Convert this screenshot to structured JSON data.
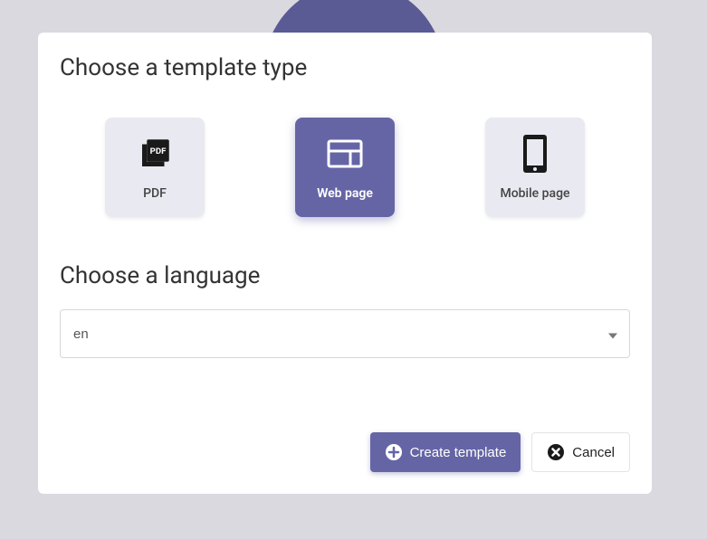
{
  "modal": {
    "template_type_title": "Choose a template type",
    "options": [
      {
        "id": "pdf",
        "label": "PDF",
        "selected": false
      },
      {
        "id": "webpage",
        "label": "Web page",
        "selected": true
      },
      {
        "id": "mobilepage",
        "label": "Mobile page",
        "selected": false
      }
    ],
    "language_title": "Choose a language",
    "language_value": "en"
  },
  "buttons": {
    "create": "Create template",
    "cancel": "Cancel"
  },
  "colors": {
    "accent": "#6565a6",
    "card_bg": "#e9e9f1"
  }
}
